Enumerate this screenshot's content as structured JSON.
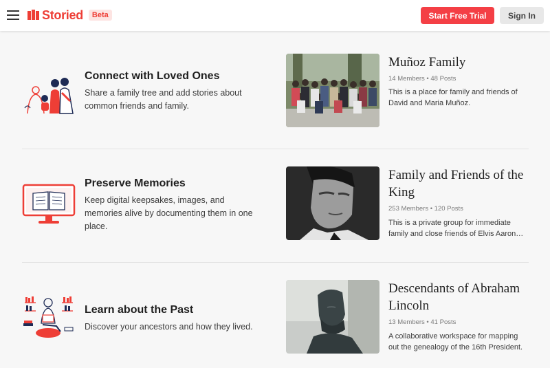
{
  "header": {
    "brand": "Storied",
    "beta": "Beta",
    "trial_label": "Start Free Trial",
    "signin_label": "Sign In"
  },
  "colors": {
    "brand": "#ee3e36",
    "cta": "#f43f45",
    "navy": "#1e2b55"
  },
  "features": [
    {
      "title": "Connect with Loved Ones",
      "desc": "Share a family tree and add stories about common friends and family."
    },
    {
      "title": "Preserve Memories",
      "desc": "Keep digital keepsakes, images, and memories alive by documenting them in one place."
    },
    {
      "title": "Learn about the Past",
      "desc": "Discover your ancestors and how they lived."
    }
  ],
  "groups": [
    {
      "name": "Muñoz Family",
      "meta": "14 Members • 48 Posts",
      "desc": "This is a place for family and friends of David and Maria Muñoz."
    },
    {
      "name": "Family and Friends of the King",
      "meta": "253 Members • 120 Posts",
      "desc": "This is a private group for immediate family and close friends of Elvis Aaron Presley."
    },
    {
      "name": "Descendants of Abraham Lincoln",
      "meta": "13 Members • 41 Posts",
      "desc": "A collaborative workspace for mapping out the genealogy of the 16th President."
    }
  ]
}
